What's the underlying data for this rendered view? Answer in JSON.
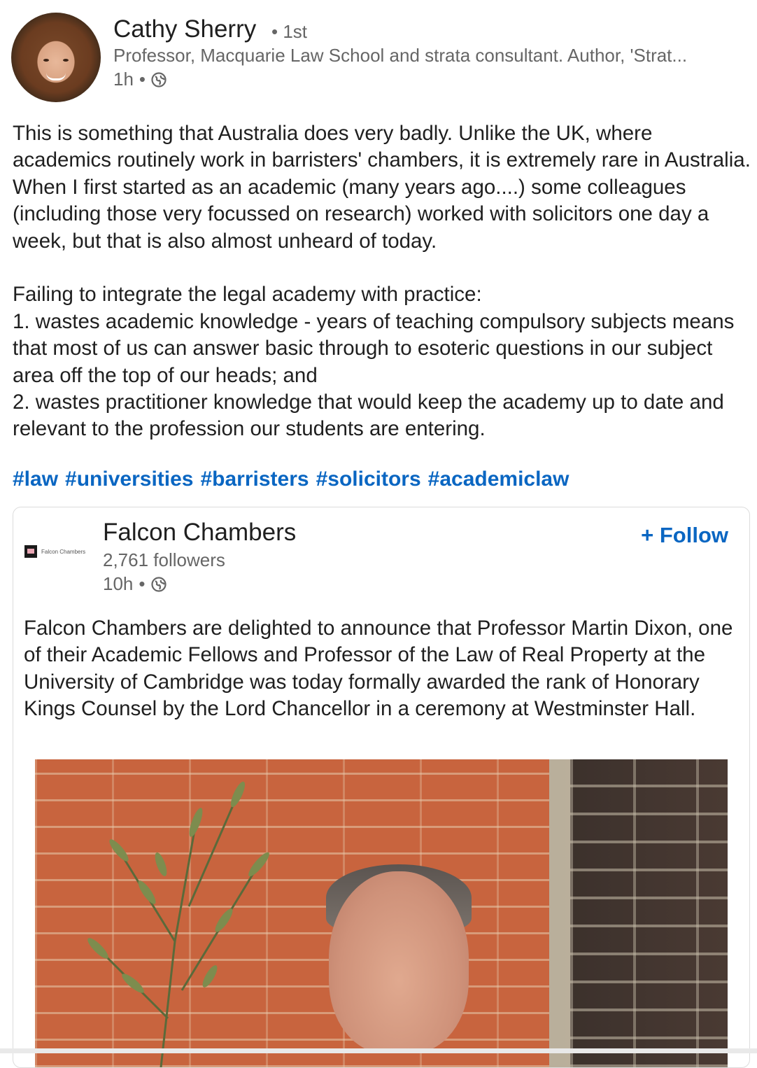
{
  "author": {
    "name": "Cathy Sherry",
    "degree": "• 1st",
    "headline": "Professor, Macquarie Law School and strata consultant. Author, 'Strat...",
    "time": "1h",
    "visibility_icon": "globe-icon"
  },
  "post": {
    "paragraphs": [
      "This is something that Australia does very badly. Unlike the UK, where academics routinely work in barristers' chambers, it is extremely rare in Australia. When I first started as an academic (many years ago....) some colleagues (including those very focussed on research) worked with solicitors one day a week, but that is also almost unheard of today.",
      "Failing to integrate the legal academy with practice:",
      "1. wastes academic knowledge - years of teaching compulsory subjects means that most of us can answer basic through to esoteric questions in our subject area off the top of our heads; and",
      "2. wastes practitioner knowledge that would keep the academy up to date and relevant to the profession our students are entering."
    ],
    "hashtags": [
      "#law",
      "#universities",
      "#barristers",
      "#solicitors",
      "#academiclaw"
    ]
  },
  "shared_post": {
    "company_name": "Falcon Chambers",
    "logo_text": "Falcon Chambers",
    "followers": "2,761 followers",
    "time": "10h",
    "visibility_icon": "globe-icon",
    "follow_label": "+ Follow",
    "body": "Falcon Chambers are delighted to announce that Professor Martin Dixon, one of their Academic Fellows and Professor of the Law of Real Property at the University of Cambridge was today formally awarded the rank of Honorary Kings Counsel by the Lord Chancellor in a ceremony at Westminster Hall."
  },
  "colors": {
    "link": "#0a66c2",
    "text": "#1f1f1f",
    "muted": "#666666"
  }
}
